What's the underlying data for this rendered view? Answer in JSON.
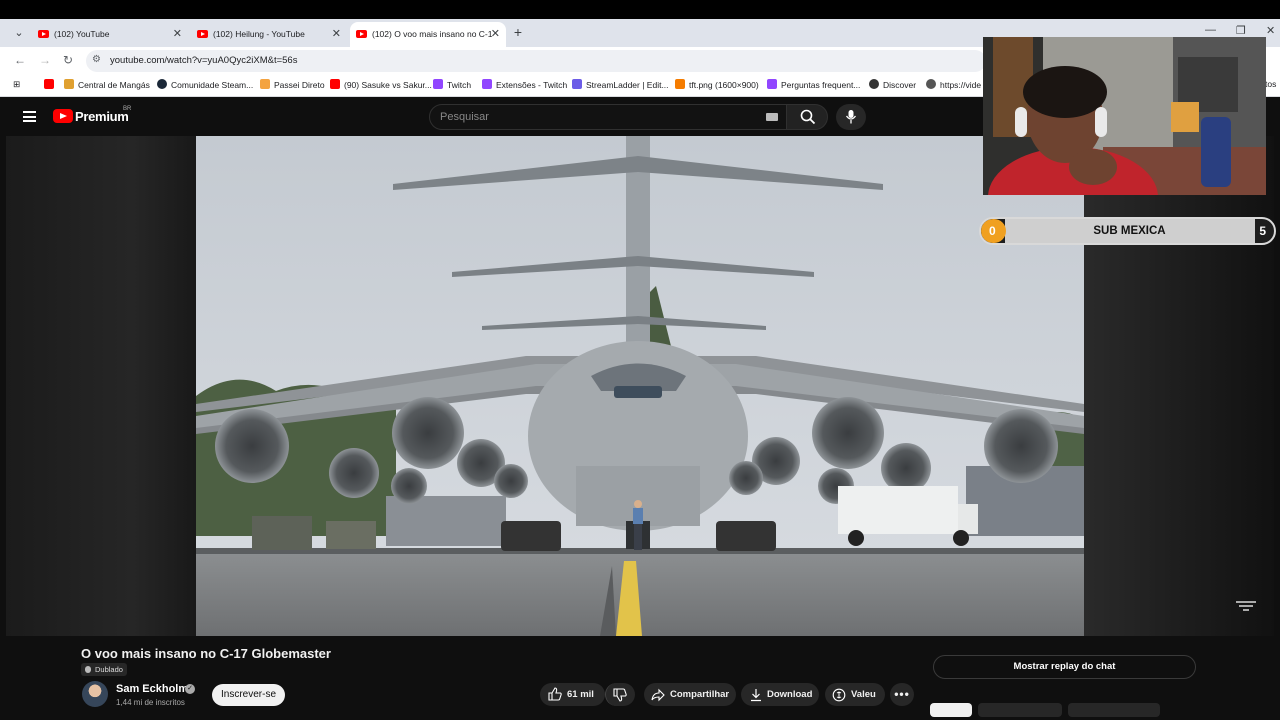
{
  "browser": {
    "tabs": [
      {
        "label": "(102) YouTube"
      },
      {
        "label": "(102) Heilung - YouTube"
      },
      {
        "label": "(102) O voo mais insano no C-1"
      }
    ],
    "url": "youtube.com/watch?v=yuA0Qyc2iXM&t=56s",
    "bookmarks": [
      {
        "label": "Central de Mangás",
        "color": "#e0a030"
      },
      {
        "label": "Comunidade Steam...",
        "color": "#1b2838"
      },
      {
        "label": "Passei Direto",
        "color": "#f4a340"
      },
      {
        "label": "(90) Sasuke vs Sakur...",
        "color": "#ff0000"
      },
      {
        "label": "Twitch",
        "color": "#9146ff"
      },
      {
        "label": "Extensões - Twitch",
        "color": "#9146ff"
      },
      {
        "label": "StreamLadder | Edit...",
        "color": "#6c5ce7"
      },
      {
        "label": "tft.png (1600×900)",
        "color": "#f57c00"
      },
      {
        "label": "Perguntas frequent...",
        "color": "#9146ff"
      },
      {
        "label": "Discover",
        "color": "#333333"
      },
      {
        "label": "https://vide",
        "color": "#555555"
      },
      {
        "label": "tos",
        "color": "#555555"
      }
    ]
  },
  "youtube": {
    "brand": "Premium",
    "region": "BR",
    "search_placeholder": "Pesquisar"
  },
  "overlay": {
    "sub_goal": {
      "label": "SUB MEXICA",
      "current": "0",
      "target": "5",
      "progress_fraction": 0
    }
  },
  "video": {
    "title": "O voo mais insano no C-17 Globemaster",
    "dub_badge": "Dublado",
    "channel": "Sam Eckholm",
    "subscribers": "1,44 mi de inscritos",
    "subscribe_label": "Inscrever-se",
    "likes": "61 mil",
    "share_label": "Compartilhar",
    "download_label": "Download",
    "thanks_label": "Valeu",
    "chat_replay_label": "Mostrar replay do chat"
  },
  "colors": {
    "accent": "#ff0000",
    "goal_fill": "#f0a020"
  },
  "icons": [
    "menu-icon",
    "search-icon",
    "mic-icon",
    "like-icon",
    "dislike-icon",
    "share-icon",
    "download-icon",
    "thanks-icon",
    "more-icon",
    "verified-icon"
  ]
}
